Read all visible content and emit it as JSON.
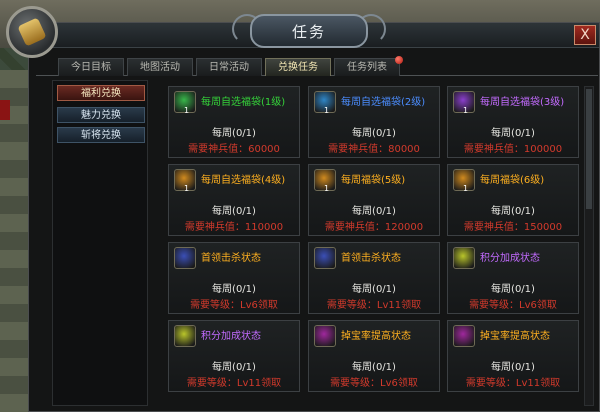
{
  "window": {
    "title": "任务",
    "close_label": "X"
  },
  "tabs": [
    {
      "label": "今日目标",
      "active": false
    },
    {
      "label": "地图活动",
      "active": false
    },
    {
      "label": "日常活动",
      "active": false
    },
    {
      "label": "兑换任务",
      "active": true
    },
    {
      "label": "任务列表",
      "active": false,
      "notification": true
    }
  ],
  "sidebar": {
    "items": [
      {
        "label": "福利兑换",
        "active": true
      },
      {
        "label": "魅力兑换",
        "active": false
      },
      {
        "label": "斩将兑换",
        "active": false
      }
    ]
  },
  "cards": [
    {
      "name": "每周自选福袋(1级)",
      "name_color": "#35d33a",
      "icon": "green-lucky-bag-icon",
      "icon_color": "#38b64a",
      "quantity": "1",
      "count": "每周(0/1)",
      "requirement": "需要神兵值：60000"
    },
    {
      "name": "每周自选福袋(2级)",
      "name_color": "#4b8dff",
      "icon": "blue-lucky-bag-icon",
      "icon_color": "#2f86c6",
      "quantity": "1",
      "count": "每周(0/1)",
      "requirement": "需要神兵值：80000"
    },
    {
      "name": "每周自选福袋(3级)",
      "name_color": "#c36bff",
      "icon": "purple-lucky-bag-icon",
      "icon_color": "#8a3fcc",
      "quantity": "1",
      "count": "每周(0/1)",
      "requirement": "需要神兵值：100000"
    },
    {
      "name": "每周自选福袋(4级)",
      "name_color": "#ffb020",
      "icon": "orange-lucky-bag-icon",
      "icon_color": "#d08a1e",
      "quantity": "1",
      "count": "每周(0/1)",
      "requirement": "需要神兵值：110000"
    },
    {
      "name": "每周福袋(5级)",
      "name_color": "#ffb020",
      "icon": "orange-lucky-bag-icon",
      "icon_color": "#d08a1e",
      "quantity": "1",
      "count": "每周(0/1)",
      "requirement": "需要神兵值：120000"
    },
    {
      "name": "每周福袋(6级)",
      "name_color": "#ffb020",
      "icon": "orange-lucky-bag-icon",
      "icon_color": "#d08a1e",
      "quantity": "1",
      "count": "每周(0/1)",
      "requirement": "需要神兵值：150000"
    },
    {
      "name": "首领击杀状态",
      "name_color": "#ffb020",
      "icon": "knight-helmet-icon",
      "icon_color": "#3b4fb7",
      "quantity": "",
      "count": "每周(0/1)",
      "requirement": "需要等级：Lv6领取"
    },
    {
      "name": "首领击杀状态",
      "name_color": "#ffb020",
      "icon": "knight-helmet-icon",
      "icon_color": "#3b4fb7",
      "quantity": "",
      "count": "每周(0/1)",
      "requirement": "需要等级：Lv11领取"
    },
    {
      "name": "积分加成状态",
      "name_color": "#c36bff",
      "icon": "cp-badge-icon",
      "icon_color": "#b9c52a",
      "quantity": "",
      "count": "每周(0/1)",
      "requirement": "需要等级：Lv6领取"
    },
    {
      "name": "积分加成状态",
      "name_color": "#c36bff",
      "icon": "cp-badge-icon",
      "icon_color": "#b9c52a",
      "quantity": "",
      "count": "每周(0/1)",
      "requirement": "需要等级：Lv11领取"
    },
    {
      "name": "掉宝率提高状态",
      "name_color": "#ffb020",
      "icon": "treasure-drop-icon",
      "icon_color": "#a0289d",
      "quantity": "",
      "count": "每周(0/1)",
      "requirement": "需要等级：Lv6领取"
    },
    {
      "name": "掉宝率提高状态",
      "name_color": "#ffb020",
      "icon": "treasure-drop-icon",
      "icon_color": "#a0289d",
      "quantity": "",
      "count": "每周(0/1)",
      "requirement": "需要等级：Lv11领取"
    }
  ]
}
